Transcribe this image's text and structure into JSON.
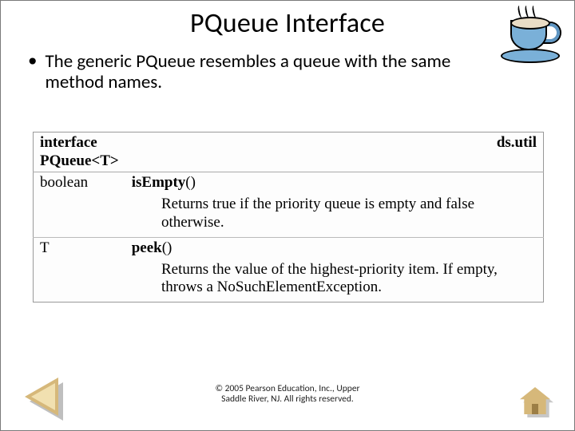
{
  "title": "PQueue Interface",
  "bullet": "The generic PQueue resembles a queue with the same method names.",
  "api": {
    "header_left": "interface PQueue<T>",
    "header_right": "ds.util",
    "rows": [
      {
        "ret": "boolean",
        "method": "isEmpty",
        "params": "()",
        "desc": "Returns true if the priority queue is empty and false otherwise."
      },
      {
        "ret": "T",
        "method": "peek",
        "params": "()",
        "desc": "Returns the value of the highest-priority item. If empty, throws a NoSuchElementException."
      }
    ]
  },
  "copyright_line1": "© 2005 Pearson Education, Inc., Upper",
  "copyright_line2": "Saddle River, NJ.  All rights reserved.",
  "icons": {
    "coffee": "coffee-cup-icon",
    "prev": "previous-slide-triangle",
    "home": "home-icon"
  }
}
